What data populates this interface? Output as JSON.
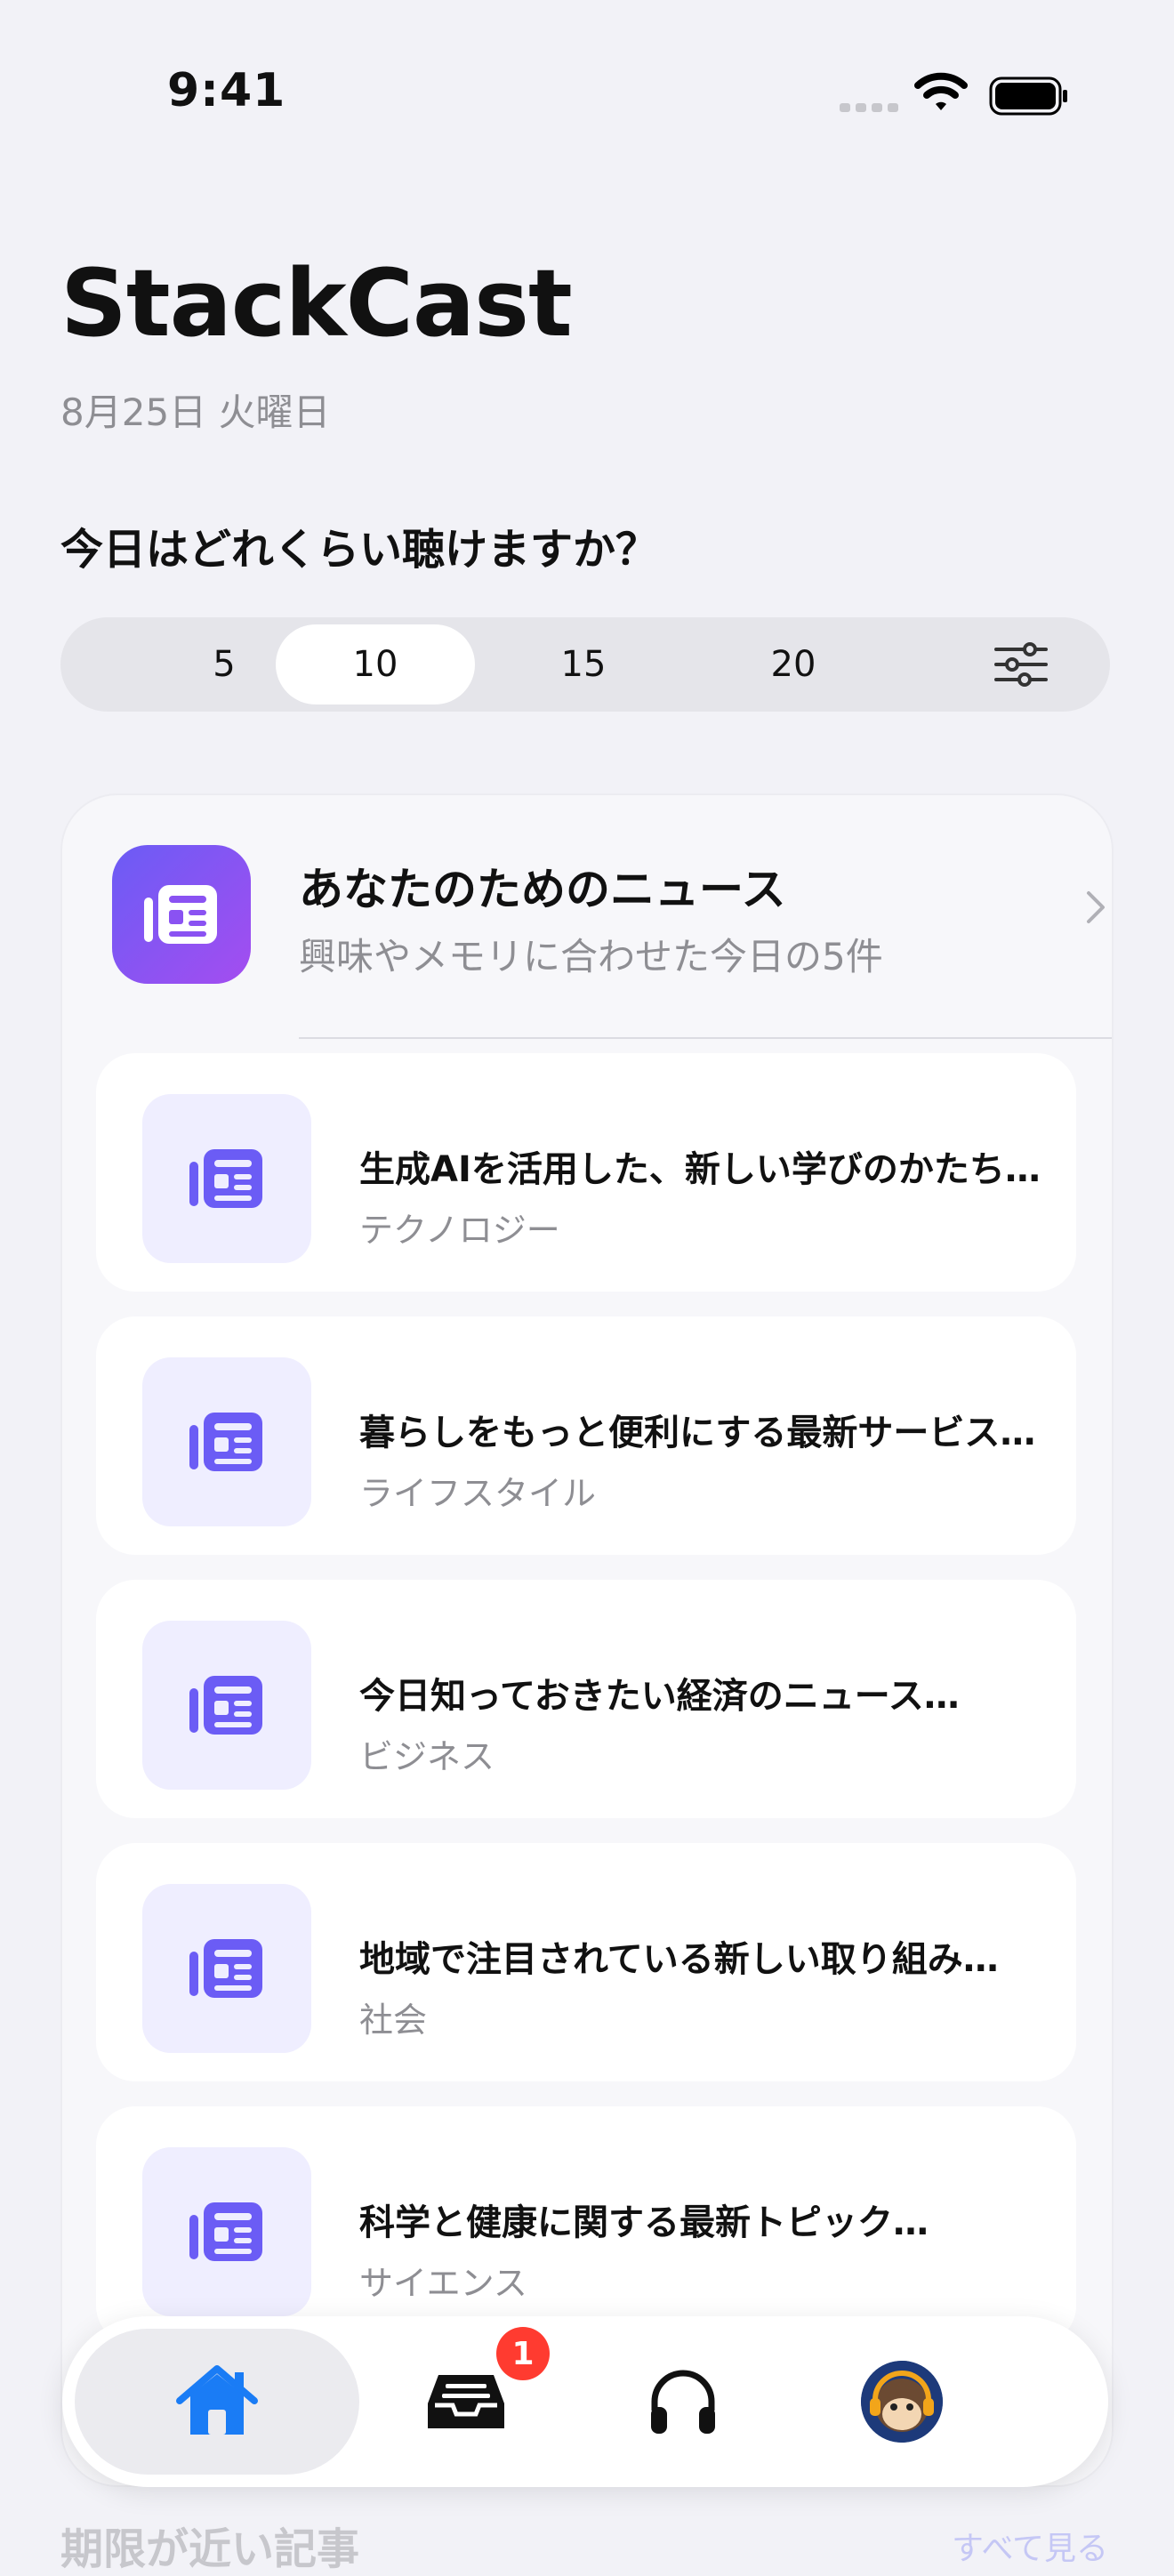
{
  "status_bar": {
    "time": "9:41"
  },
  "header": {
    "title": "StackCast",
    "date": "8月25日 火曜日"
  },
  "duration": {
    "question": "今日はどれくらい聴けますか？",
    "options": [
      "5",
      "10",
      "15",
      "20"
    ],
    "selected": "10",
    "filter_icon": "sliders-icon"
  },
  "news": {
    "title": "あなたのためのニュース",
    "subtitle": "興味やメモリに合わせた今日の5件",
    "icon": "newspaper-icon",
    "articles": [
      {
        "title": "生成AIを活用した、新しい学びのかたち…",
        "category": "テクノロジー"
      },
      {
        "title": "暮らしをもっと便利にする最新サービス…",
        "category": "ライフスタイル"
      },
      {
        "title": "今日知っておきたい経済のニュース…",
        "category": "ビジネス"
      },
      {
        "title": "地域で注目されている新しい取り組み…",
        "category": "社会"
      },
      {
        "title": "科学と健康に関する最新トピック…",
        "category": "サイエンス"
      }
    ]
  },
  "tab_bar": {
    "items": [
      "home-icon",
      "inbox-icon",
      "headphones-icon",
      "profile-avatar"
    ],
    "inbox_badge": "1",
    "active_color": "#1a7cf5"
  },
  "bottom": {
    "section_title": "期限が近い記事",
    "see_all": "すべて見る"
  }
}
